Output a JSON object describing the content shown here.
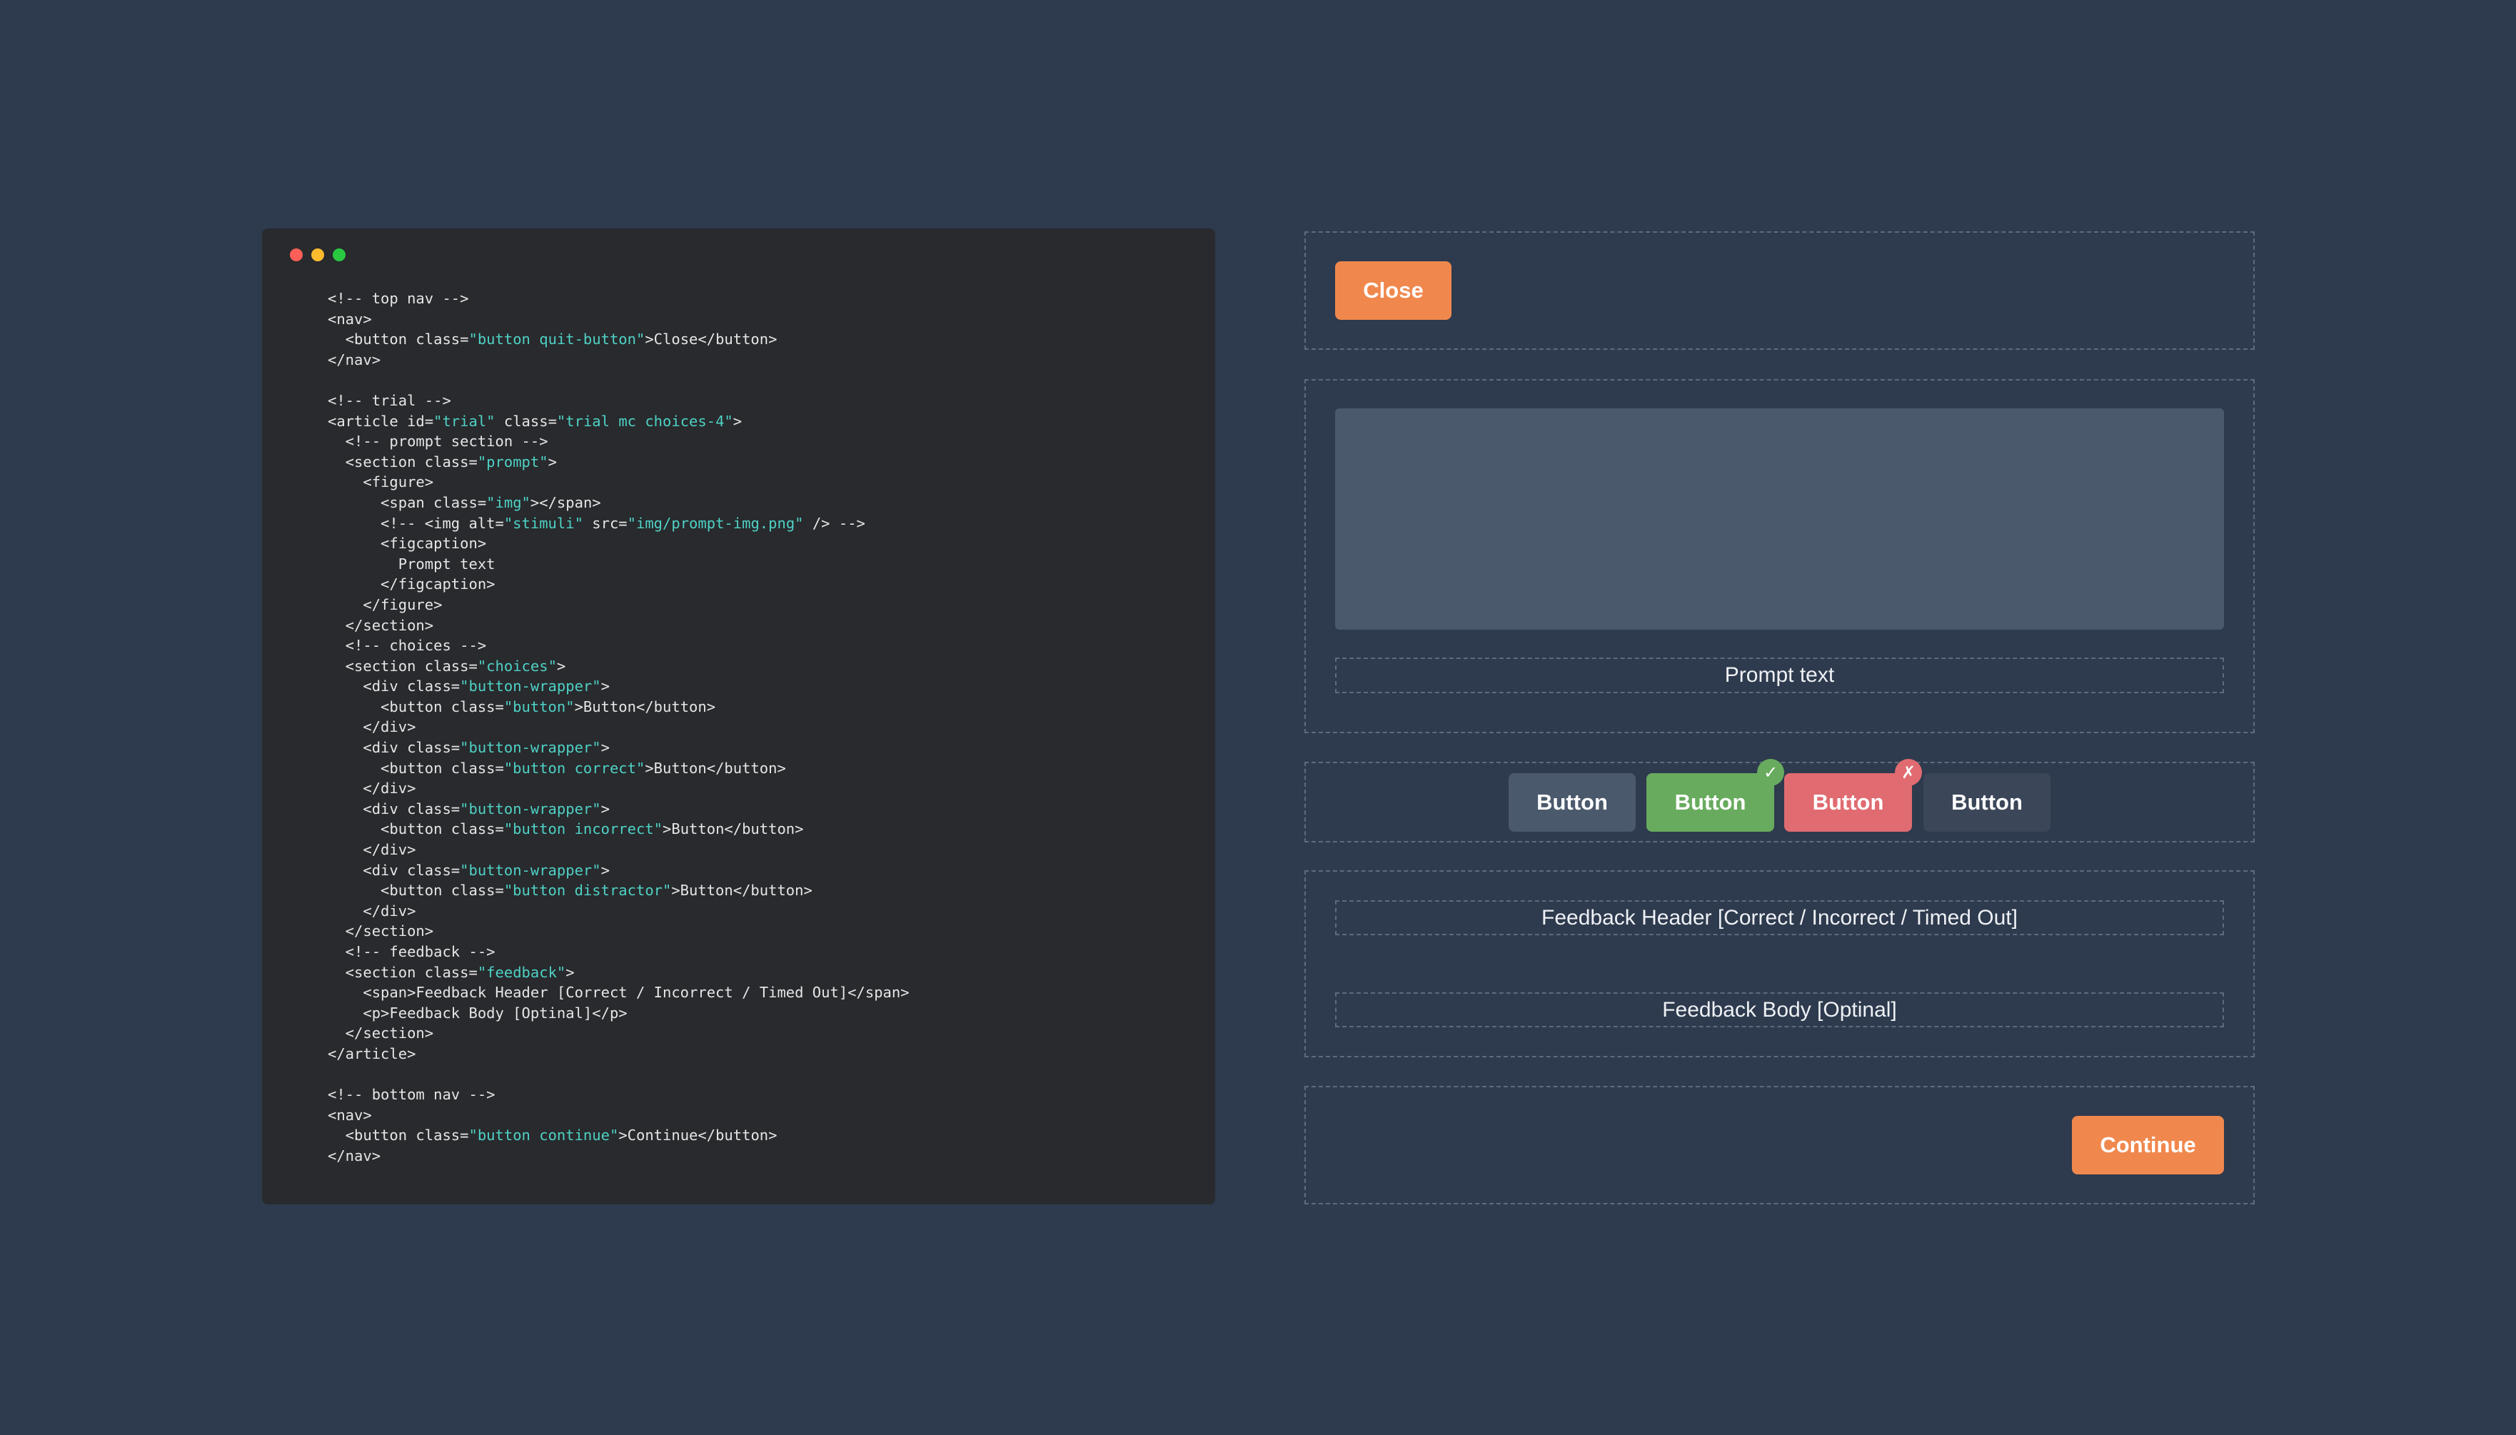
{
  "code_window": {
    "lines": [
      [
        {
          "t": "<!-- top nav -->"
        }
      ],
      [
        {
          "t": "<nav>"
        }
      ],
      [
        {
          "t": "  <button class="
        },
        {
          "t": "\"button quit-button\"",
          "s": 1
        },
        {
          "t": ">Close</button>"
        }
      ],
      [
        {
          "t": "</nav>"
        }
      ],
      [
        {
          "t": ""
        }
      ],
      [
        {
          "t": "<!-- trial -->"
        }
      ],
      [
        {
          "t": "<article id="
        },
        {
          "t": "\"trial\"",
          "s": 1
        },
        {
          "t": " class="
        },
        {
          "t": "\"trial mc choices-4\"",
          "s": 1
        },
        {
          "t": ">"
        }
      ],
      [
        {
          "t": "  <!-- prompt section -->"
        }
      ],
      [
        {
          "t": "  <section class="
        },
        {
          "t": "\"prompt\"",
          "s": 1
        },
        {
          "t": ">"
        }
      ],
      [
        {
          "t": "    <figure>"
        }
      ],
      [
        {
          "t": "      <span class="
        },
        {
          "t": "\"img\"",
          "s": 1
        },
        {
          "t": "></span>"
        }
      ],
      [
        {
          "t": "      <!-- <img alt="
        },
        {
          "t": "\"stimuli\"",
          "s": 1
        },
        {
          "t": " src="
        },
        {
          "t": "\"img/prompt-img.png\"",
          "s": 1
        },
        {
          "t": " /> -->"
        }
      ],
      [
        {
          "t": "      <figcaption>"
        }
      ],
      [
        {
          "t": "        Prompt text"
        }
      ],
      [
        {
          "t": "      </figcaption>"
        }
      ],
      [
        {
          "t": "    </figure>"
        }
      ],
      [
        {
          "t": "  </section>"
        }
      ],
      [
        {
          "t": "  <!-- choices -->"
        }
      ],
      [
        {
          "t": "  <section class="
        },
        {
          "t": "\"choices\"",
          "s": 1
        },
        {
          "t": ">"
        }
      ],
      [
        {
          "t": "    <div class="
        },
        {
          "t": "\"button-wrapper\"",
          "s": 1
        },
        {
          "t": ">"
        }
      ],
      [
        {
          "t": "      <button class="
        },
        {
          "t": "\"button\"",
          "s": 1
        },
        {
          "t": ">Button</button>"
        }
      ],
      [
        {
          "t": "    </div>"
        }
      ],
      [
        {
          "t": "    <div class="
        },
        {
          "t": "\"button-wrapper\"",
          "s": 1
        },
        {
          "t": ">"
        }
      ],
      [
        {
          "t": "      <button class="
        },
        {
          "t": "\"button correct\"",
          "s": 1
        },
        {
          "t": ">Button</button>"
        }
      ],
      [
        {
          "t": "    </div>"
        }
      ],
      [
        {
          "t": "    <div class="
        },
        {
          "t": "\"button-wrapper\"",
          "s": 1
        },
        {
          "t": ">"
        }
      ],
      [
        {
          "t": "      <button class="
        },
        {
          "t": "\"button incorrect\"",
          "s": 1
        },
        {
          "t": ">Button</button>"
        }
      ],
      [
        {
          "t": "    </div>"
        }
      ],
      [
        {
          "t": "    <div class="
        },
        {
          "t": "\"button-wrapper\"",
          "s": 1
        },
        {
          "t": ">"
        }
      ],
      [
        {
          "t": "      <button class="
        },
        {
          "t": "\"button distractor\"",
          "s": 1
        },
        {
          "t": ">Button</button>"
        }
      ],
      [
        {
          "t": "    </div>"
        }
      ],
      [
        {
          "t": "  </section>"
        }
      ],
      [
        {
          "t": "  <!-- feedback -->"
        }
      ],
      [
        {
          "t": "  <section class="
        },
        {
          "t": "\"feedback\"",
          "s": 1
        },
        {
          "t": ">"
        }
      ],
      [
        {
          "t": "    <span>Feedback Header [Correct / Incorrect / Timed Out]</span>"
        }
      ],
      [
        {
          "t": "    <p>Feedback Body [Optinal]</p>"
        }
      ],
      [
        {
          "t": "  </section>"
        }
      ],
      [
        {
          "t": "</article>"
        }
      ],
      [
        {
          "t": ""
        }
      ],
      [
        {
          "t": "<!-- bottom nav -->"
        }
      ],
      [
        {
          "t": "<nav>"
        }
      ],
      [
        {
          "t": "  <button class="
        },
        {
          "t": "\"button continue\"",
          "s": 1
        },
        {
          "t": ">Continue</button>"
        }
      ],
      [
        {
          "t": "</nav>"
        }
      ]
    ]
  },
  "preview": {
    "top_nav": {
      "close_label": "Close"
    },
    "prompt": {
      "text": "Prompt text"
    },
    "choices": {
      "buttons": [
        {
          "label": "Button",
          "state": "default"
        },
        {
          "label": "Button",
          "state": "correct",
          "badge": "✓"
        },
        {
          "label": "Button",
          "state": "incorrect",
          "badge": "✗"
        },
        {
          "label": "Button",
          "state": "distractor"
        }
      ]
    },
    "feedback": {
      "header": "Feedback Header [Correct / Incorrect / Timed Out]",
      "body": "Feedback Body [Optinal]"
    },
    "bottom_nav": {
      "continue_label": "Continue"
    }
  },
  "colors": {
    "background": "#2e3a4d",
    "code_bg": "#282a2d",
    "code_string": "#4fd1c5",
    "accent_orange": "#f0884e",
    "correct_green": "#68ab5e",
    "incorrect_red": "#e06b70",
    "neutral_button": "#4b596c",
    "distractor_button": "#3b4759"
  }
}
